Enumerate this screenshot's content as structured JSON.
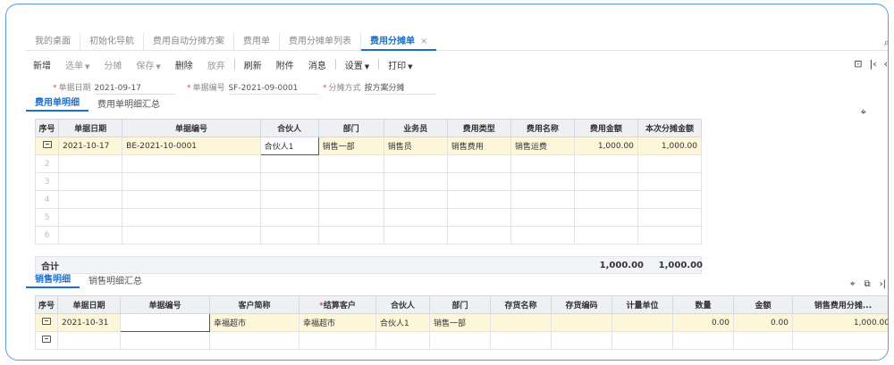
{
  "tabs": [
    {
      "label": "我的桌面",
      "active": false
    },
    {
      "label": "初始化导航",
      "active": false
    },
    {
      "label": "费用自动分摊方案",
      "active": false
    },
    {
      "label": "费用单",
      "active": false
    },
    {
      "label": "费用分摊单列表",
      "active": false
    },
    {
      "label": "费用分摊单",
      "active": true,
      "close": "×"
    }
  ],
  "toolbar": {
    "new": "新增",
    "select": "选单",
    "split": "分摊",
    "save": "保存",
    "delete": "删除",
    "discard": "放弃",
    "refresh": "刷新",
    "attach": "附件",
    "message": "消息",
    "settings": "设置",
    "print": "打印"
  },
  "header": {
    "date_label": "单据日期",
    "date_value": "2021-09-17",
    "number_label": "单据编号",
    "number_value": "SF-2021-09-0001",
    "method_label": "分摊方式",
    "method_value": "按方案分摊"
  },
  "expense_tabs": [
    "费用单明细",
    "费用单明细汇总"
  ],
  "expense_table": {
    "columns": [
      "序号",
      "单据日期",
      "单据编号",
      "合伙人",
      "部门",
      "业务员",
      "费用类型",
      "费用名称",
      "费用金额",
      "本次分摊金额"
    ],
    "rows": [
      {
        "seq": "",
        "date": "2021-10-17",
        "number": "BE-2021-10-0001",
        "partner": "合伙人1",
        "dept": "销售一部",
        "salesman": "销售员",
        "type": "销售费用",
        "name": "销售运费",
        "amount": "1,000.00",
        "alloc": "1,000.00"
      },
      {
        "seq": "2"
      },
      {
        "seq": "3"
      },
      {
        "seq": "4"
      },
      {
        "seq": "5"
      },
      {
        "seq": "6"
      }
    ],
    "total_label": "合计",
    "total_amount": "1,000.00",
    "total_alloc": "1,000.00"
  },
  "sales_tabs": [
    "销售明细",
    "销售明细汇总"
  ],
  "sales_table": {
    "columns": [
      "序号",
      "单据日期",
      "单据编号",
      "客户简称",
      "结算客户",
      "合伙人",
      "部门",
      "存货名称",
      "存货编码",
      "计量单位",
      "数量",
      "金额",
      "销售费用分摊..."
    ],
    "rows": [
      {
        "seq": "",
        "date": "2021-10-31",
        "number": "",
        "customer": "幸福超市",
        "settle": "幸福超市",
        "partner": "合伙人1",
        "dept": "销售一部",
        "inv_name": "",
        "inv_code": "",
        "unit": "",
        "qty": "0.00",
        "amount": "0.00",
        "alloc": "1,000.00"
      },
      {
        "seq": ""
      }
    ]
  }
}
